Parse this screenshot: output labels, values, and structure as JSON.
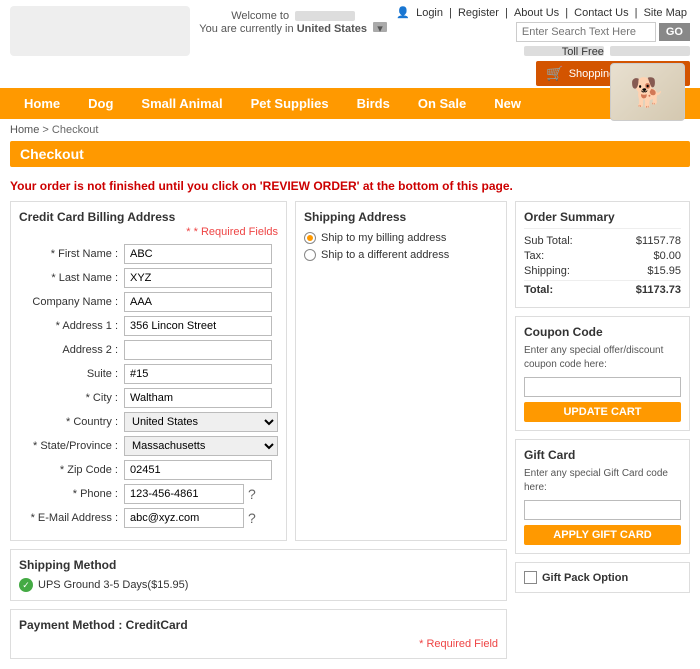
{
  "header": {
    "welcome_text": "Welcome to",
    "location_text": "You are currently in",
    "location_country": "United States",
    "links": [
      "Login",
      "Register",
      "About Us",
      "Contact Us",
      "Site Map"
    ],
    "search_placeholder": "Enter Search Text Here",
    "search_btn": "GO",
    "toll_free_label": "Toll Free",
    "cart_label": "Shopping Cart (1 Item)"
  },
  "nav": {
    "items": [
      "Home",
      "Dog",
      "Small Animal",
      "Pet Supplies",
      "Birds",
      "On Sale",
      "New"
    ]
  },
  "breadcrumb": {
    "home": "Home",
    "separator": ">",
    "current": "Checkout"
  },
  "page_title": "Checkout",
  "warning": "Your order is not finished until you click on 'REVIEW ORDER' at the bottom of this page.",
  "billing": {
    "title": "Credit Card Billing Address",
    "required_note": "* Required Fields",
    "fields": {
      "first_name_label": "* First Name :",
      "first_name_value": "ABC",
      "last_name_label": "* Last Name :",
      "last_name_value": "XYZ",
      "company_label": "Company Name :",
      "company_value": "AAA",
      "address1_label": "* Address 1 :",
      "address1_value": "356 Lincon Street",
      "address2_label": "Address 2 :",
      "address2_value": "",
      "suite_label": "Suite :",
      "suite_value": "#15",
      "city_label": "* City :",
      "city_value": "Waltham",
      "country_label": "* Country :",
      "country_value": "United States",
      "state_label": "* State/Province :",
      "state_value": "Massachusetts",
      "zip_label": "* Zip Code :",
      "zip_value": "02451",
      "phone_label": "* Phone :",
      "phone_value": "123-456-4861",
      "email_label": "* E-Mail Address :",
      "email_value": "abc@xyz.com"
    }
  },
  "shipping": {
    "title": "Shipping Address",
    "option1": "Ship to my billing address",
    "option2": "Ship to a different address"
  },
  "shipping_method": {
    "title": "Shipping Method",
    "option": "UPS Ground 3-5 Days($15.95)"
  },
  "payment": {
    "title": "Payment Method : CreditCard",
    "required_note": "* Required Field"
  },
  "order_summary": {
    "title": "Order Summary",
    "rows": [
      {
        "label": "Sub Total:",
        "value": "$1157.78"
      },
      {
        "label": "Tax:",
        "value": "$0.00"
      },
      {
        "label": "Shipping:",
        "value": "$15.95"
      },
      {
        "label": "Total:",
        "value": "$1173.73",
        "is_total": true
      }
    ]
  },
  "coupon": {
    "title": "Coupon Code",
    "description": "Enter any special offer/discount coupon code here:",
    "placeholder": "",
    "btn_label": "UPDATE CART"
  },
  "giftcard": {
    "title": "Gift Card",
    "description": "Enter any special Gift Card code here:",
    "placeholder": "",
    "btn_label": "APPLY GIFT CARD"
  },
  "giftpack": {
    "label": "Gift Pack Option"
  }
}
